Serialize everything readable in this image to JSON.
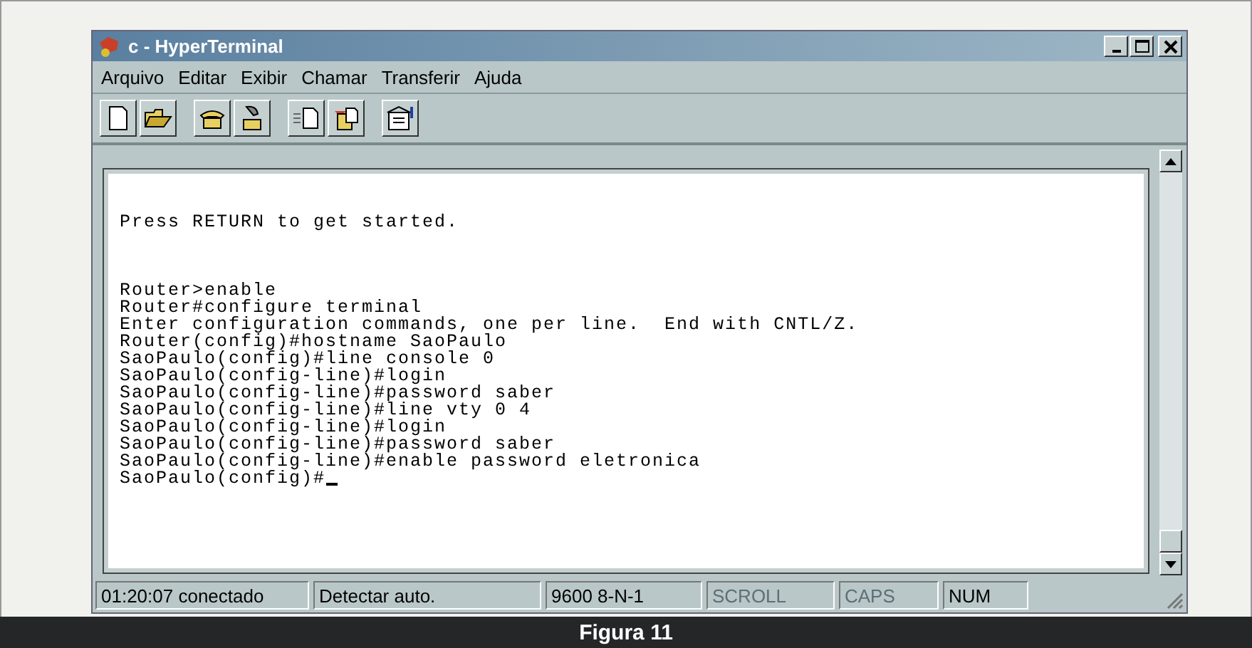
{
  "window": {
    "title": "c - HyperTerminal"
  },
  "menu": [
    "Arquivo",
    "Editar",
    "Exibir",
    "Chamar",
    "Transferir",
    "Ajuda"
  ],
  "toolbar": [
    {
      "kind": "new"
    },
    {
      "kind": "open"
    },
    {
      "kind": "call"
    },
    {
      "kind": "hangup"
    },
    {
      "kind": "send"
    },
    {
      "kind": "receive"
    },
    {
      "kind": "properties"
    }
  ],
  "terminal": {
    "blocks": [
      [
        "Press RETURN to get started."
      ],
      [
        "Router>enable",
        "Router#configure terminal",
        "Enter configuration commands, one per line.  End with CNTL/Z.",
        "Router(config)#hostname SaoPaulo",
        "SaoPaulo(config)#line console 0",
        "SaoPaulo(config-line)#login",
        "SaoPaulo(config-line)#password saber",
        "SaoPaulo(config-line)#line vty 0 4",
        "SaoPaulo(config-line)#login",
        "SaoPaulo(config-line)#password saber",
        "SaoPaulo(config-line)#enable password eletronica",
        "SaoPaulo(config)#"
      ]
    ]
  },
  "status_bar": [
    {
      "text": "01:20:07 conectado",
      "disabled": false
    },
    {
      "text": "Detectar auto.",
      "disabled": false
    },
    {
      "text": "9600 8-N-1",
      "disabled": false
    },
    {
      "text": "SCROLL",
      "disabled": true
    },
    {
      "text": "CAPS",
      "disabled": true
    },
    {
      "text": "NUM",
      "disabled": false
    }
  ],
  "caption": "Figura 11"
}
